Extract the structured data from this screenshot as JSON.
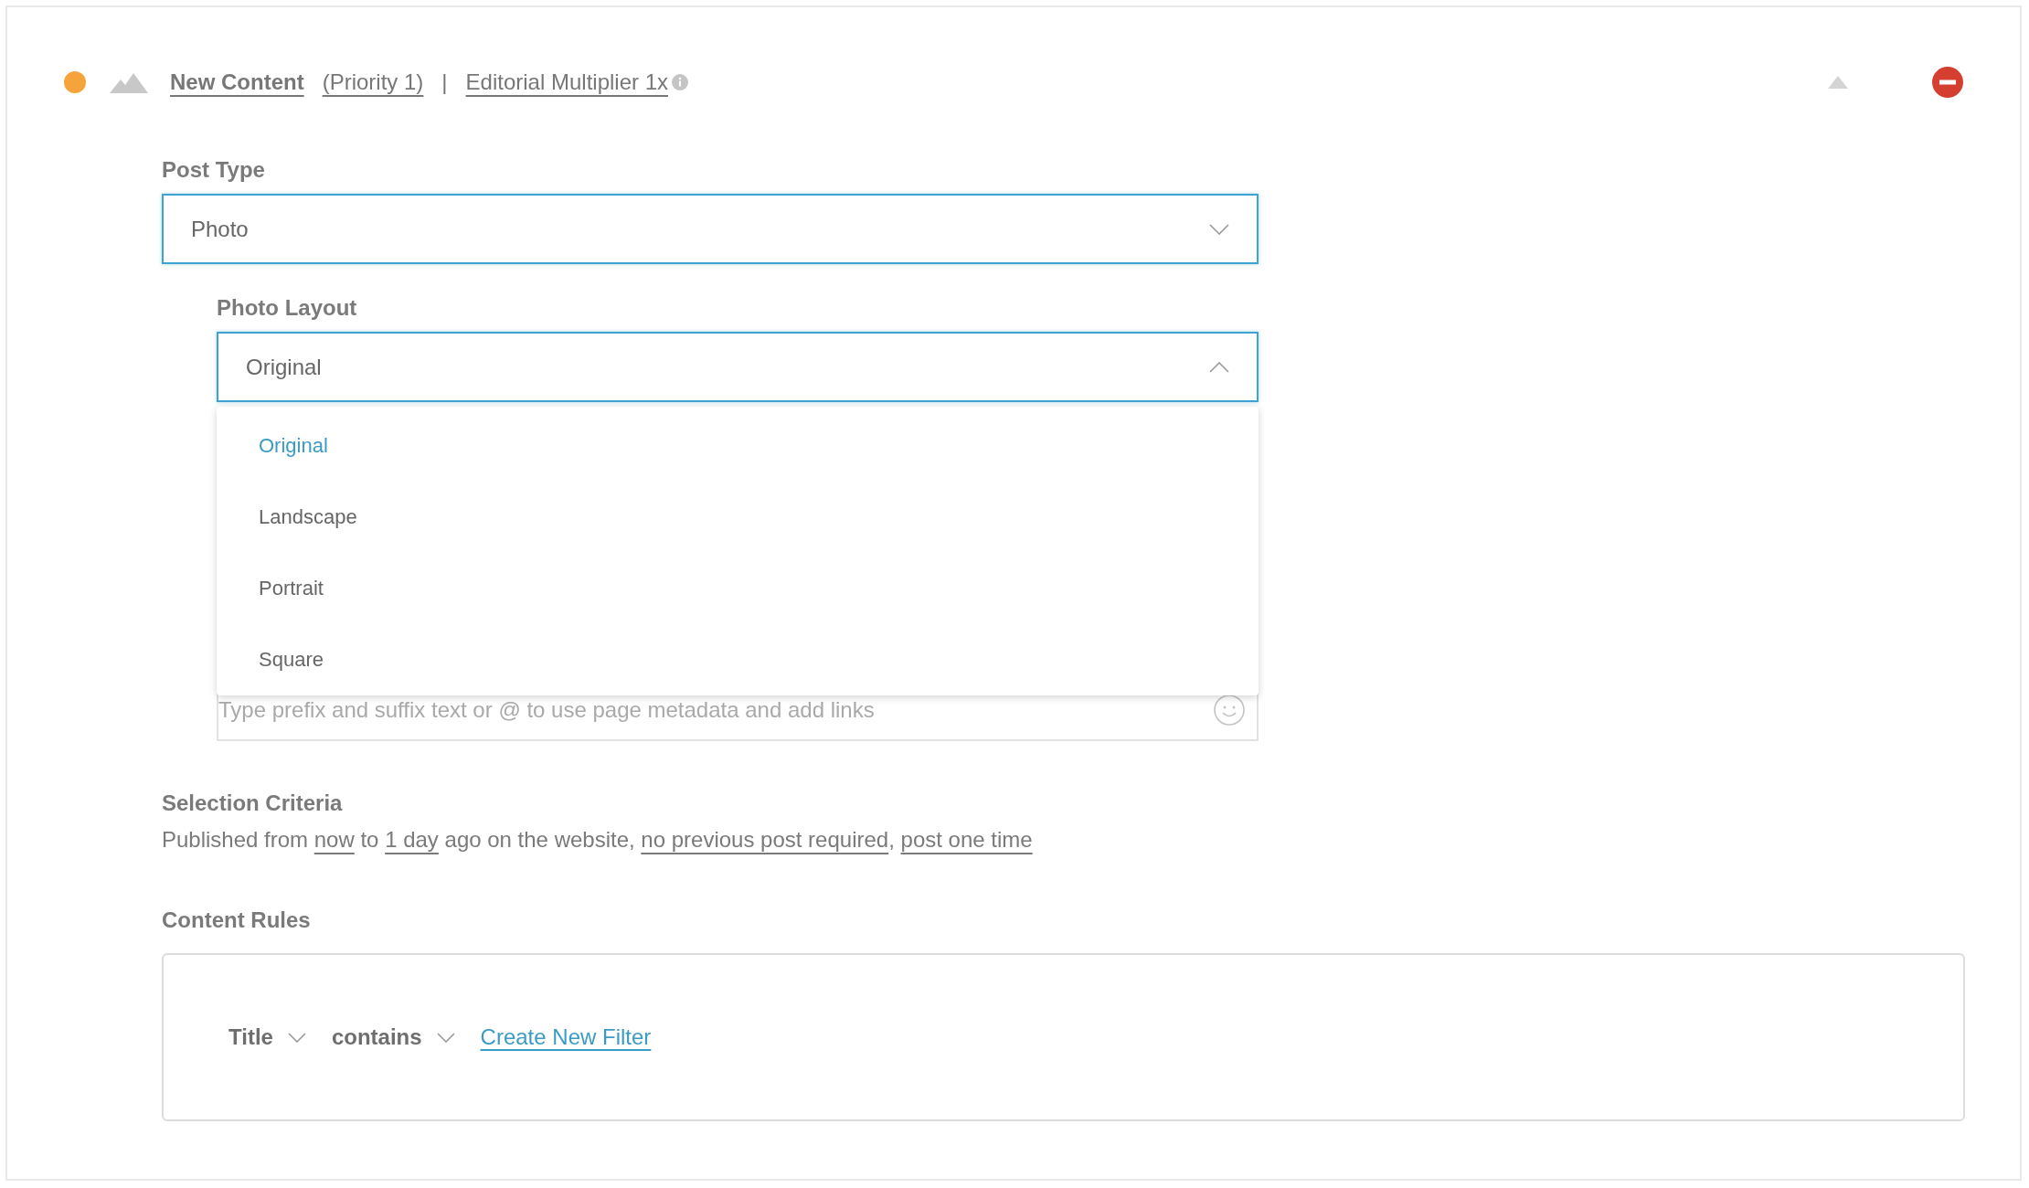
{
  "header": {
    "title": "New Content",
    "priority": "(Priority 1)",
    "separator": "|",
    "multiplier": "Editorial Multiplier 1x"
  },
  "post_type": {
    "label": "Post Type",
    "value": "Photo",
    "expanded": false
  },
  "photo_layout": {
    "label": "Photo Layout",
    "value": "Original",
    "expanded": true,
    "options": [
      {
        "label": "Original",
        "selected": true
      },
      {
        "label": "Landscape",
        "selected": false
      },
      {
        "label": "Portrait",
        "selected": false
      },
      {
        "label": "Square",
        "selected": false
      }
    ]
  },
  "caption": {
    "placeholder": "Type prefix and suffix text or @ to use page metadata and add links"
  },
  "selection_criteria": {
    "label": "Selection Criteria",
    "parts": [
      {
        "kind": "text",
        "text": "Published from "
      },
      {
        "kind": "link",
        "text": "now"
      },
      {
        "kind": "text",
        "text": " to "
      },
      {
        "kind": "link",
        "text": "1 day"
      },
      {
        "kind": "text",
        "text": " ago on the website, "
      },
      {
        "kind": "link",
        "text": "no previous post required"
      },
      {
        "kind": "text",
        "text": ", "
      },
      {
        "kind": "link",
        "text": "post one time"
      }
    ]
  },
  "content_rules": {
    "label": "Content Rules",
    "field": "Title",
    "operator": "contains",
    "create_link": "Create New Filter"
  }
}
